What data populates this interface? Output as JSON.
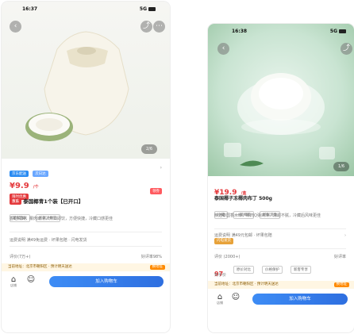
{
  "left": {
    "status": {
      "time": "16:37",
      "carrier": "",
      "signal": "5G"
    },
    "pager": "2/6",
    "price": "¥9.9",
    "price_unit": "/个",
    "promo_tag": "限时优惠",
    "right_tag": "领券",
    "title_tag": "京东",
    "title": "泰国椰青1个装【已开口】",
    "tags": [
      "新鲜直发",
      "买就送吸管"
    ],
    "desc": "香甜清爽，椰肉嫩滑，开口即饮，方便快捷，冷藏口感更佳",
    "ship_row": "运费说明 满49免运费 · 坏果包赔 · 闪电发货",
    "service_row": "评价(7万+)",
    "service_right": "好评率98%",
    "notice": "当前地址：北京市朝阳区 · 预计明天送达",
    "notice_btn": "换地址",
    "store_label": "店铺",
    "cart_label": "加入购物车",
    "shipping_chip": "京东配送",
    "delivery_chip": "次日达"
  },
  "right": {
    "status": {
      "time": "16:38",
      "carrier": "",
      "signal": "5G"
    },
    "pager": "1/6",
    "price": "¥19.9",
    "price_unit": "/盒",
    "title": "泰国椰子冻椰肉布丁 500g",
    "tags": [
      "冷藏",
      "一级椰肉",
      "新鲜现做"
    ],
    "desc": "精选泰国香水椰，椰肉Q弹爽滑，清甜不腻，冷藏后风味更佳",
    "ship_row": "运费说明 满49元包邮 · 坏果包赔",
    "ship_row2": "闪电发货",
    "review_label": "评价 (2000+)",
    "review_right": "好评率",
    "compare_price": "97",
    "compare_label": "到手价",
    "compare_items": [
      "原价对比",
      "价格保护",
      "新客专享"
    ],
    "notice": "当前地址：北京市朝阳区 · 预计明天送达",
    "notice_btn": "换地址",
    "store_label": "店铺",
    "cart_label": "加入购物车"
  }
}
